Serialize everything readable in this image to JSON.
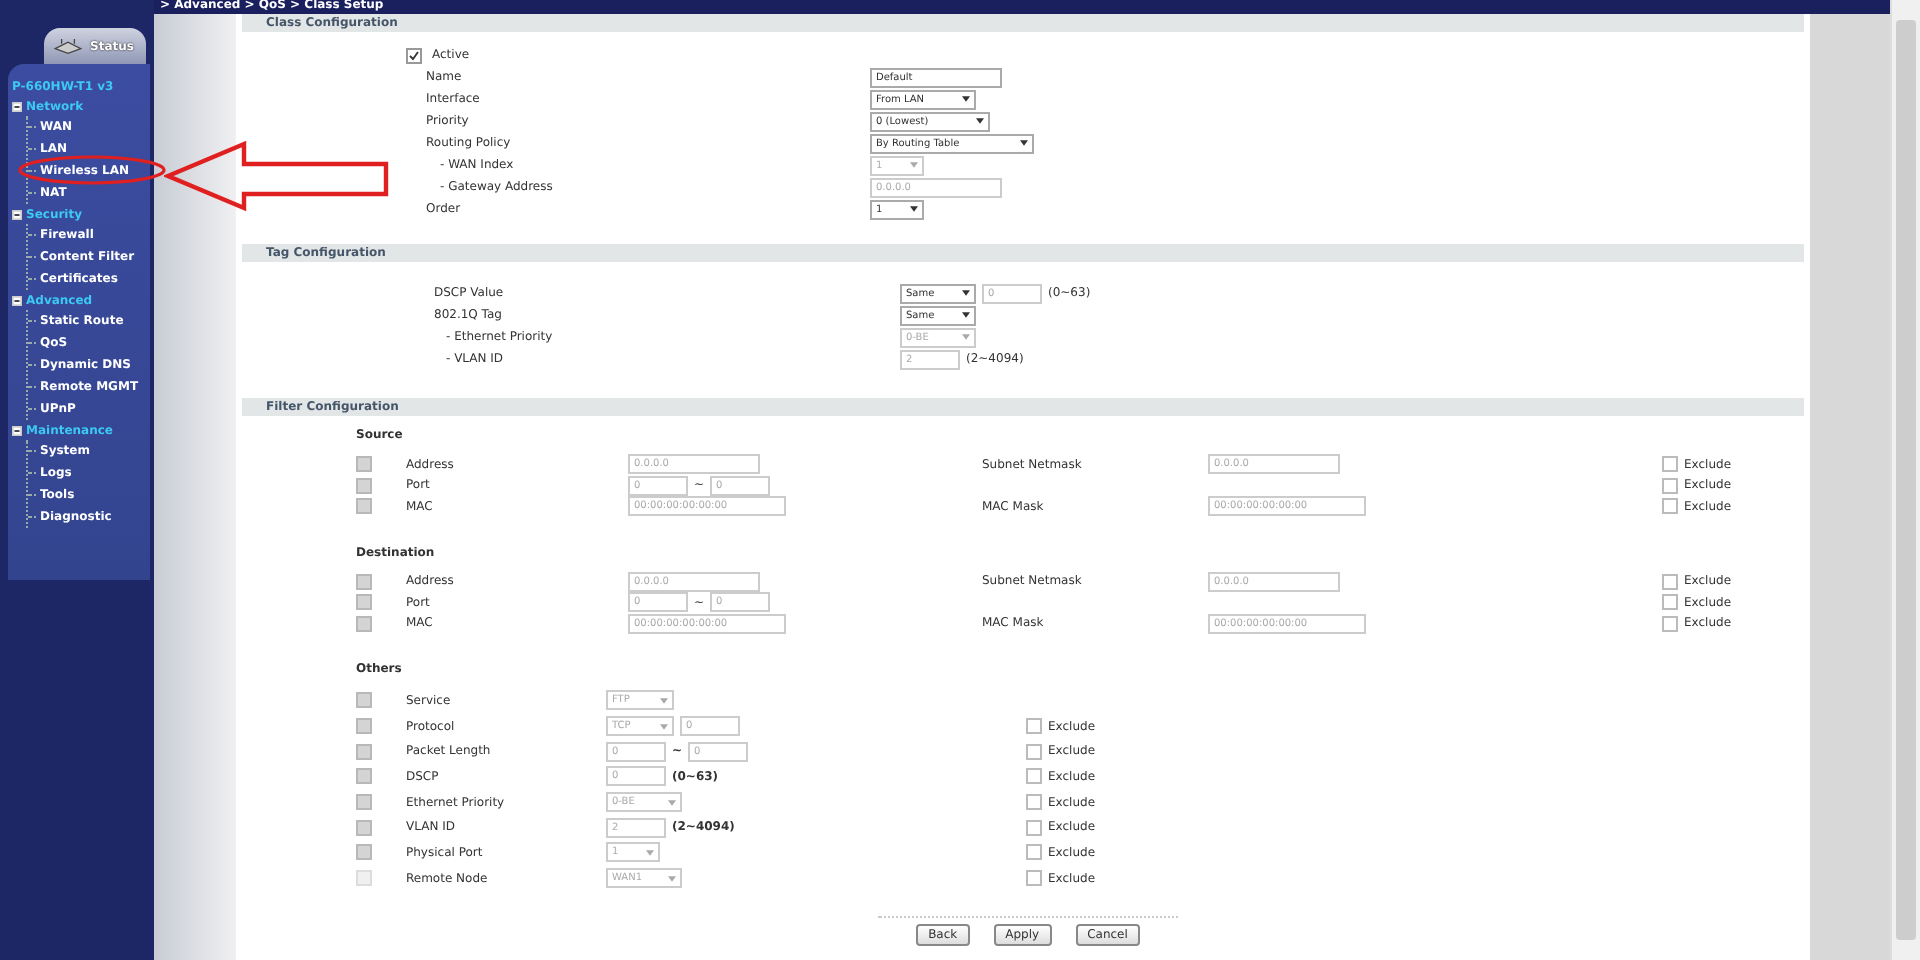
{
  "breadcrumb": "> Advanced > QoS > Class Setup",
  "sidebar": {
    "status_tab": "Status",
    "model": "P-660HW-T1 v3",
    "groups": [
      {
        "label": "Network",
        "expanded": true,
        "items": [
          "WAN",
          "LAN",
          "Wireless LAN",
          "NAT"
        ]
      },
      {
        "label": "Security",
        "expanded": true,
        "items": [
          "Firewall",
          "Content Filter",
          "Certificates"
        ]
      },
      {
        "label": "Advanced",
        "expanded": true,
        "items": [
          "Static Route",
          "QoS",
          "Dynamic DNS",
          "Remote MGMT",
          "UPnP"
        ]
      },
      {
        "label": "Maintenance",
        "expanded": true,
        "items": [
          "System",
          "Logs",
          "Tools",
          "Diagnostic"
        ]
      }
    ]
  },
  "class_configuration": {
    "title": "Class Configuration",
    "active": {
      "label": "Active",
      "checked": true
    },
    "fields": [
      {
        "label": "Name",
        "controls": [
          {
            "kind": "input",
            "value": "Default",
            "disabled": false
          }
        ]
      },
      {
        "label": "Interface",
        "controls": [
          {
            "kind": "select",
            "value": "From LAN",
            "disabled": false
          }
        ]
      },
      {
        "label": "Priority",
        "controls": [
          {
            "kind": "select",
            "value": "0 (Lowest)",
            "disabled": false
          }
        ]
      },
      {
        "label": "Routing Policy",
        "controls": [
          {
            "kind": "select",
            "value": "By Routing Table",
            "disabled": false
          }
        ],
        "children": [
          {
            "label": "- WAN Index",
            "controls": [
              {
                "kind": "select",
                "value": "1",
                "disabled": true
              }
            ]
          },
          {
            "label": "- Gateway Address",
            "controls": [
              {
                "kind": "input",
                "value": "0.0.0.0",
                "disabled": true
              }
            ]
          }
        ]
      },
      {
        "label": "Order",
        "controls": [
          {
            "kind": "select",
            "value": "1",
            "disabled": false
          }
        ]
      }
    ]
  },
  "tag_configuration": {
    "title": "Tag Configuration",
    "fields": [
      {
        "label": "DSCP Value",
        "controls": [
          {
            "kind": "select",
            "value": "Same",
            "disabled": false
          },
          {
            "kind": "input",
            "value": "0",
            "disabled": true
          },
          {
            "kind": "text",
            "value": "(0~63)"
          }
        ]
      },
      {
        "label": "802.1Q Tag",
        "controls": [
          {
            "kind": "select",
            "value": "Same",
            "disabled": false
          }
        ],
        "children": [
          {
            "label": "- Ethernet Priority",
            "controls": [
              {
                "kind": "select",
                "value": "0-BE",
                "disabled": true
              }
            ]
          },
          {
            "label": "- VLAN ID",
            "controls": [
              {
                "kind": "input",
                "value": "2",
                "disabled": true
              },
              {
                "kind": "text",
                "value": "(2~4094)"
              }
            ]
          }
        ]
      }
    ]
  },
  "filter_configuration": {
    "title": "Filter Configuration",
    "groups": [
      {
        "title": "Source",
        "kind": "address",
        "rows": [
          {
            "checked": false,
            "disabled": false,
            "label": "Address",
            "controls": [
              {
                "kind": "input",
                "value": "0.0.0.0",
                "disabled": true
              }
            ],
            "mask_label": "Subnet Netmask",
            "mask_controls": [
              {
                "kind": "input",
                "value": "0.0.0.0",
                "disabled": true
              }
            ],
            "exclude": {
              "label": "Exclude",
              "checked": false
            }
          },
          {
            "checked": false,
            "disabled": false,
            "label": "Port",
            "controls": [
              {
                "kind": "input",
                "value": "0",
                "disabled": true
              },
              {
                "kind": "text",
                "value": "~"
              },
              {
                "kind": "input",
                "value": "0",
                "disabled": true
              }
            ],
            "exclude": {
              "label": "Exclude",
              "checked": false
            }
          },
          {
            "checked": false,
            "disabled": false,
            "label": "MAC",
            "controls": [
              {
                "kind": "input",
                "value": "00:00:00:00:00:00",
                "disabled": true
              }
            ],
            "mask_label": "MAC Mask",
            "mask_controls": [
              {
                "kind": "input",
                "value": "00:00:00:00:00:00",
                "disabled": true
              }
            ],
            "exclude": {
              "label": "Exclude",
              "checked": false
            }
          }
        ]
      },
      {
        "title": "Destination",
        "kind": "address",
        "rows": [
          {
            "checked": false,
            "disabled": false,
            "label": "Address",
            "controls": [
              {
                "kind": "input",
                "value": "0.0.0.0",
                "disabled": true
              }
            ],
            "mask_label": "Subnet Netmask",
            "mask_controls": [
              {
                "kind": "input",
                "value": "0.0.0.0",
                "disabled": true
              }
            ],
            "exclude": {
              "label": "Exclude",
              "checked": false
            }
          },
          {
            "checked": false,
            "disabled": false,
            "label": "Port",
            "controls": [
              {
                "kind": "input",
                "value": "0",
                "disabled": true
              },
              {
                "kind": "text",
                "value": "~"
              },
              {
                "kind": "input",
                "value": "0",
                "disabled": true
              }
            ],
            "exclude": {
              "label": "Exclude",
              "checked": false
            }
          },
          {
            "checked": false,
            "disabled": false,
            "label": "MAC",
            "controls": [
              {
                "kind": "input",
                "value": "00:00:00:00:00:00",
                "disabled": true
              }
            ],
            "mask_label": "MAC Mask",
            "mask_controls": [
              {
                "kind": "input",
                "value": "00:00:00:00:00:00",
                "disabled": true
              }
            ],
            "exclude": {
              "label": "Exclude",
              "checked": false
            }
          }
        ]
      },
      {
        "title": "Others",
        "kind": "others",
        "rows": [
          {
            "checked": false,
            "disabled": false,
            "label": "Service",
            "controls": [
              {
                "kind": "select",
                "value": "FTP",
                "disabled": true
              }
            ]
          },
          {
            "checked": false,
            "disabled": false,
            "label": "Protocol",
            "controls": [
              {
                "kind": "select",
                "value": "TCP",
                "disabled": true
              },
              {
                "kind": "input",
                "value": "0",
                "disabled": true
              }
            ],
            "exclude": {
              "label": "Exclude",
              "checked": false
            }
          },
          {
            "checked": false,
            "disabled": false,
            "label": "Packet Length",
            "controls": [
              {
                "kind": "input",
                "value": "0",
                "disabled": true
              },
              {
                "kind": "text",
                "value": "~"
              },
              {
                "kind": "input",
                "value": "0",
                "disabled": true
              }
            ],
            "exclude": {
              "label": "Exclude",
              "checked": false
            }
          },
          {
            "checked": false,
            "disabled": false,
            "label": "DSCP",
            "controls": [
              {
                "kind": "input",
                "value": "0",
                "disabled": true
              },
              {
                "kind": "text",
                "value": "(0~63)"
              }
            ],
            "exclude": {
              "label": "Exclude",
              "checked": false
            }
          },
          {
            "checked": false,
            "disabled": false,
            "label": "Ethernet Priority",
            "controls": [
              {
                "kind": "select",
                "value": "0-BE",
                "disabled": true
              }
            ],
            "exclude": {
              "label": "Exclude",
              "checked": false
            }
          },
          {
            "checked": false,
            "disabled": false,
            "label": "VLAN ID",
            "controls": [
              {
                "kind": "input",
                "value": "2",
                "disabled": true
              },
              {
                "kind": "text",
                "value": "(2~4094)"
              }
            ],
            "exclude": {
              "label": "Exclude",
              "checked": false
            }
          },
          {
            "checked": false,
            "disabled": false,
            "label": "Physical Port",
            "controls": [
              {
                "kind": "select",
                "value": "1",
                "disabled": true
              }
            ],
            "exclude": {
              "label": "Exclude",
              "checked": false
            }
          },
          {
            "checked": false,
            "disabled": true,
            "label": "Remote Node",
            "controls": [
              {
                "kind": "select",
                "value": "WAN1",
                "disabled": true
              }
            ],
            "exclude": {
              "label": "Exclude",
              "checked": false
            }
          }
        ]
      }
    ]
  },
  "buttons": [
    "Back",
    "Apply",
    "Cancel"
  ]
}
